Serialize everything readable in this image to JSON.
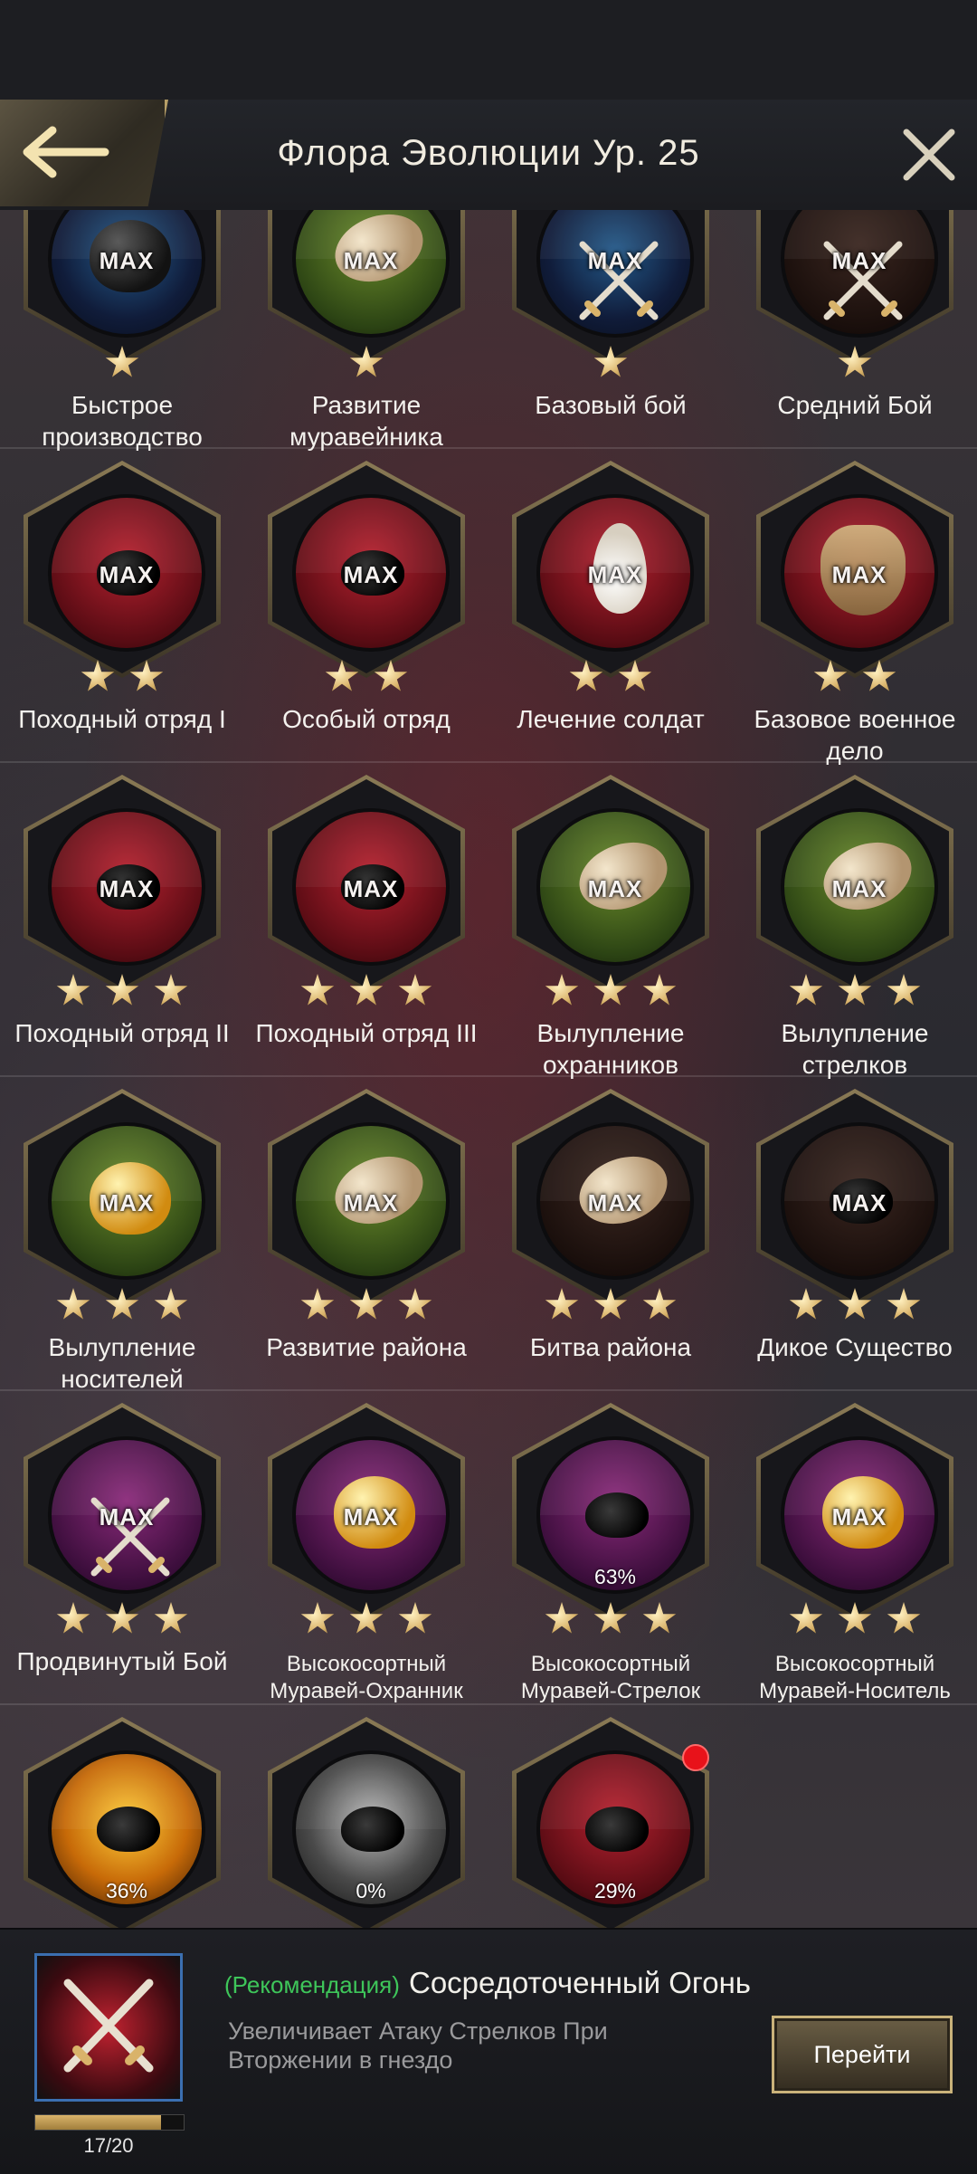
{
  "header": {
    "title": "Флора Эволюции Ур. 25"
  },
  "skills": [
    {
      "label": "Быстрое производство",
      "status": "MAX",
      "stars": 1,
      "theme": "blue",
      "art": "clock"
    },
    {
      "label": "Развитие муравейника",
      "status": "MAX",
      "stars": 1,
      "theme": "green",
      "art": "egg"
    },
    {
      "label": "Базовый бой",
      "status": "MAX",
      "stars": 1,
      "theme": "blue",
      "art": "swords"
    },
    {
      "label": "Средний Бой",
      "status": "MAX",
      "stars": 1,
      "theme": "dark",
      "art": "swords"
    },
    {
      "label": "Походный отряд I",
      "status": "MAX",
      "stars": 2,
      "theme": "red",
      "art": "ant"
    },
    {
      "label": "Особый отряд",
      "status": "MAX",
      "stars": 2,
      "theme": "red",
      "art": "ant"
    },
    {
      "label": "Лечение солдат",
      "status": "MAX",
      "stars": 2,
      "theme": "red",
      "art": "drop"
    },
    {
      "label": "Базовое военное дело",
      "status": "MAX",
      "stars": 2,
      "theme": "red",
      "art": "crest"
    },
    {
      "label": "Походный отряд II",
      "status": "MAX",
      "stars": 3,
      "theme": "red",
      "art": "ant"
    },
    {
      "label": "Походный отряд III",
      "status": "MAX",
      "stars": 3,
      "theme": "red",
      "art": "ant"
    },
    {
      "label": "Вылупление охранников",
      "status": "MAX",
      "stars": 3,
      "theme": "green",
      "art": "egg"
    },
    {
      "label": "Вылупление стрелков",
      "status": "MAX",
      "stars": 3,
      "theme": "green",
      "art": "egg"
    },
    {
      "label": "Вылупление носителей",
      "status": "MAX",
      "stars": 3,
      "theme": "green",
      "art": "amber"
    },
    {
      "label": "Развитие района",
      "status": "MAX",
      "stars": 3,
      "theme": "green",
      "art": "egg"
    },
    {
      "label": "Битва района",
      "status": "MAX",
      "stars": 3,
      "theme": "dark",
      "art": "skull"
    },
    {
      "label": "Дикое Существо",
      "status": "MAX",
      "stars": 3,
      "theme": "dark",
      "art": "beetle"
    },
    {
      "label": "Продвинутый Бой",
      "status": "MAX",
      "stars": 3,
      "theme": "purple",
      "art": "swords"
    },
    {
      "label": "Высокосортный Муравей-Охранник",
      "status": "MAX",
      "stars": 3,
      "theme": "purple",
      "art": "amber"
    },
    {
      "label": "Высокосортный Муравей-Стрелок",
      "status": "63%",
      "stars": 3,
      "theme": "purple",
      "art": "ant"
    },
    {
      "label": "Высокосортный Муравей-Носитель",
      "status": "MAX",
      "stars": 3,
      "theme": "purple",
      "art": "amber"
    },
    {
      "label": "",
      "status": "36%",
      "stars": 0,
      "theme": "gold",
      "art": "ant"
    },
    {
      "label": "",
      "status": "0%",
      "stars": 0,
      "theme": "grey",
      "art": "ant"
    },
    {
      "label": "",
      "status": "29%",
      "stars": 0,
      "theme": "red",
      "art": "ant",
      "red_dot": true
    }
  ],
  "footer": {
    "tag": "(Рекомендация)",
    "name": "Сосредоточенный Огонь",
    "description": "Увеличивает Атаку Стрелков При Вторжении в гнездо",
    "progress_current": 17,
    "progress_max": 20,
    "progress_text": "17/20",
    "go_label": "Перейти"
  },
  "colors": {
    "accent_gold": "#c9b27a",
    "recommend_green": "#3ec65a",
    "star": "#d9b36a"
  }
}
